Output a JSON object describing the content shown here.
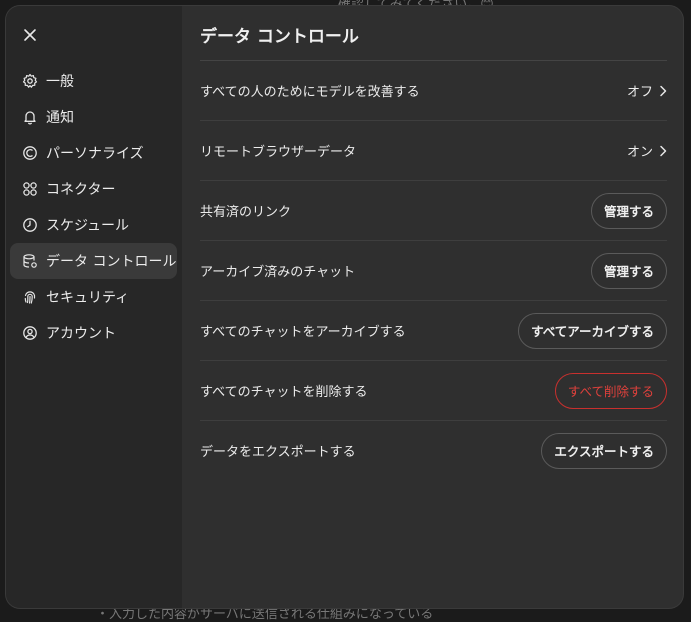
{
  "background": {
    "top_text": "確認してみてください。😊",
    "bottom_text": "・入力した内容がサーバに送信される仕組みになっている"
  },
  "sidebar": {
    "close_icon": "close-icon",
    "items": [
      {
        "label": "一般",
        "icon": "gear-icon"
      },
      {
        "label": "通知",
        "icon": "bell-icon"
      },
      {
        "label": "パーソナライズ",
        "icon": "personalize-icon"
      },
      {
        "label": "コネクター",
        "icon": "connector-icon"
      },
      {
        "label": "スケジュール",
        "icon": "clock-icon"
      },
      {
        "label": "データ コントロール",
        "icon": "database-gear-icon",
        "active": true
      },
      {
        "label": "セキュリティ",
        "icon": "fingerprint-icon"
      },
      {
        "label": "アカウント",
        "icon": "user-circle-icon"
      }
    ]
  },
  "main": {
    "title": "データ コントロール",
    "rows": [
      {
        "label": "すべての人のためにモデルを改善する",
        "value": "オフ",
        "kind": "toggle"
      },
      {
        "label": "リモートブラウザーデータ",
        "value": "オン",
        "kind": "toggle"
      },
      {
        "label": "共有済のリンク",
        "button": "管理する",
        "kind": "button"
      },
      {
        "label": "アーカイブ済みのチャット",
        "button": "管理する",
        "kind": "button"
      },
      {
        "label": "すべてのチャットをアーカイブする",
        "button": "すべてアーカイブする",
        "kind": "button"
      },
      {
        "label": "すべてのチャットを削除する",
        "button": "すべて削除する",
        "kind": "danger"
      },
      {
        "label": "データをエクスポートする",
        "button": "エクスポートする",
        "kind": "button"
      }
    ]
  },
  "colors": {
    "modal_bg": "#2f2f2f",
    "sidebar_bg": "#272727",
    "active_item_bg": "#3a3a3a",
    "danger": "#e0413c"
  }
}
